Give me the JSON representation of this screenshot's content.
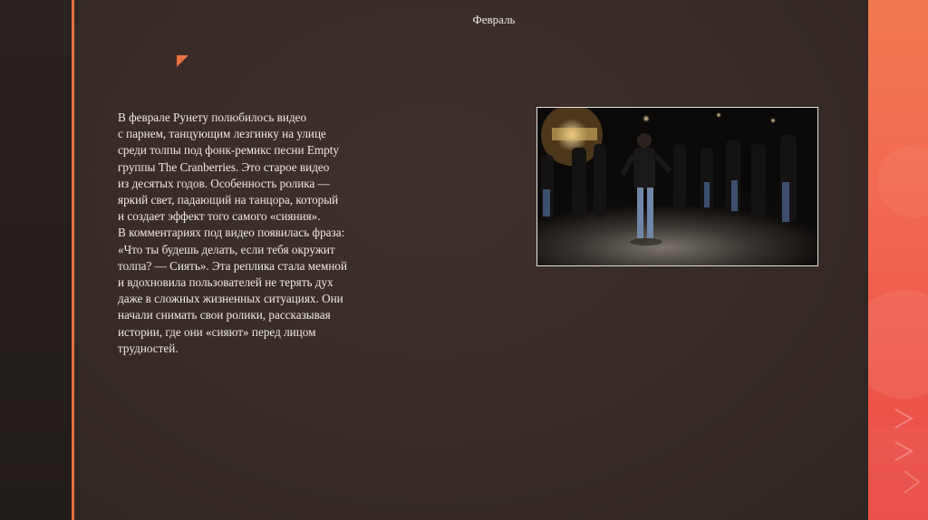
{
  "slide": {
    "title": "Февраль",
    "body_lines": [
      "В феврале Рунету полюбилось видео",
      "с парнем, танцующим лезгинку на улице",
      "среди толпы под фонк-ремикс песни Empty",
      "группы The Cranberries. Это старое видео",
      "из десятых годов. Особенность ролика —",
      "яркий свет, падающий на танцора, который",
      "и создает эффект того самого «сияния».",
      "В комментариях под видео появилась фраза:",
      "«Что ты будешь делать, если тебя окружит",
      "толпа? — Сиять». Эта реплика стала мемной",
      "и вдохновила пользователей не терять дух",
      "даже в сложных жизненных ситуациях. Они",
      "начали снимать свои ролики, рассказывая",
      "истории, где они «сияют» перед лицом",
      "трудностей."
    ]
  },
  "theme": {
    "accent": "#e8703f",
    "slide_background": "#3a2e29",
    "text_color": "#f0e9e4",
    "right_strip": "#ef5a4d"
  }
}
